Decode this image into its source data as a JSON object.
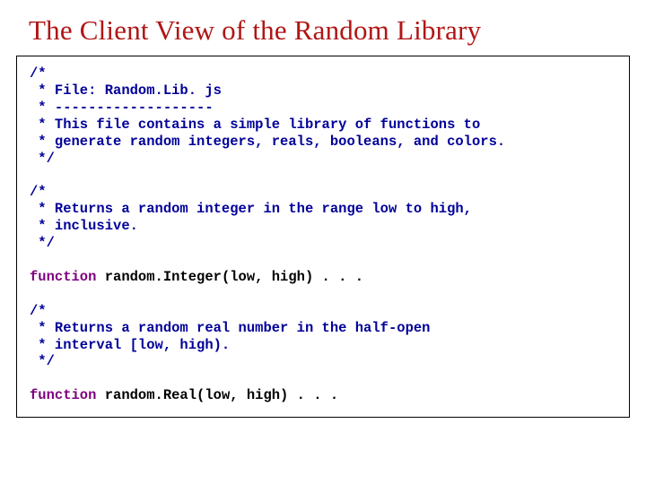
{
  "title": "The Client View of the Random Library",
  "code": {
    "comment1": "/*\n * File: Random.Lib. js\n * -------------------\n * This file contains a simple library of functions to\n * generate random integers, reals, booleans, and colors.\n */",
    "comment2": "/*\n * Returns a random integer in the range low to high,\n * inclusive.\n */",
    "func1_kw": "function ",
    "func1_sig": "random.Integer(low, high) . . .",
    "comment3": "/*\n * Returns a random real number in the half-open\n * interval [low, high).\n */",
    "func2_kw": "function ",
    "func2_sig": "random.Real(low, high) . . ."
  }
}
